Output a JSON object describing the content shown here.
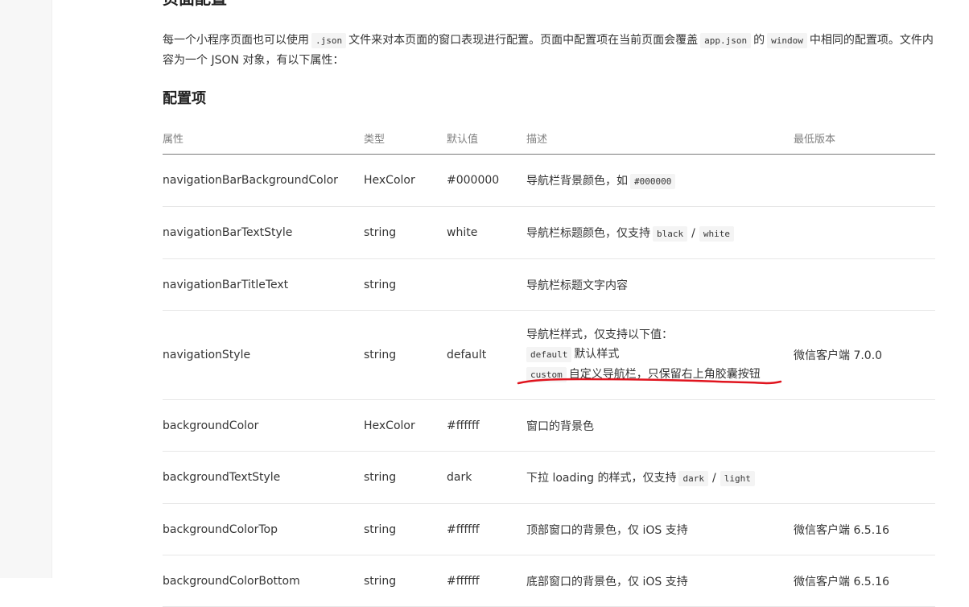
{
  "page": {
    "top_heading": "页面配置",
    "intro": {
      "part1": "每一个小程序页面也可以使用",
      "code1": ".json",
      "part2": "文件来对本页面的窗口表现进行配置。页面中配置项在当前页面会覆盖",
      "code2": "app.json",
      "part3": "的",
      "code3": "window",
      "part4": "中相同的配置项。文件内容为一个 JSON 对象，有以下属性："
    },
    "section_title": "配置项"
  },
  "table": {
    "headers": {
      "property": "属性",
      "type": "类型",
      "default": "默认值",
      "description": "描述",
      "min_version": "最低版本"
    },
    "rows": [
      {
        "property": "navigationBarBackgroundColor",
        "type": "HexColor",
        "default": "#000000",
        "desc_text": "导航栏背景颜色，如",
        "desc_code": "#000000",
        "min_version": ""
      },
      {
        "property": "navigationBarTextStyle",
        "type": "string",
        "default": "white",
        "desc_text": "导航栏标题颜色，仅支持",
        "desc_code1": "black",
        "desc_sep": "/",
        "desc_code2": "white",
        "min_version": ""
      },
      {
        "property": "navigationBarTitleText",
        "type": "string",
        "default": "",
        "desc_text": "导航栏标题文字内容",
        "min_version": ""
      },
      {
        "property": "navigationStyle",
        "type": "string",
        "default": "default",
        "desc_line1": "导航栏样式，仅支持以下值：",
        "desc_code1": "default",
        "desc_text1": "默认样式",
        "desc_code2": "custom",
        "desc_text2": "自定义导航栏，只保留右上角胶囊按钮",
        "min_version": "微信客户端 7.0.0"
      },
      {
        "property": "backgroundColor",
        "type": "HexColor",
        "default": "#ffffff",
        "desc_text": "窗口的背景色",
        "min_version": ""
      },
      {
        "property": "backgroundTextStyle",
        "type": "string",
        "default": "dark",
        "desc_text": "下拉 loading 的样式，仅支持",
        "desc_code1": "dark",
        "desc_sep": "/",
        "desc_code2": "light",
        "min_version": ""
      },
      {
        "property": "backgroundColorTop",
        "type": "string",
        "default": "#ffffff",
        "desc_text": "顶部窗口的背景色，仅 iOS 支持",
        "min_version": "微信客户端 6.5.16"
      },
      {
        "property": "backgroundColorBottom",
        "type": "string",
        "default": "#ffffff",
        "desc_text": "底部窗口的背景色，仅 iOS 支持",
        "min_version": "微信客户端 6.5.16"
      }
    ]
  },
  "annotation": {
    "underline_color": "#e0141e"
  }
}
